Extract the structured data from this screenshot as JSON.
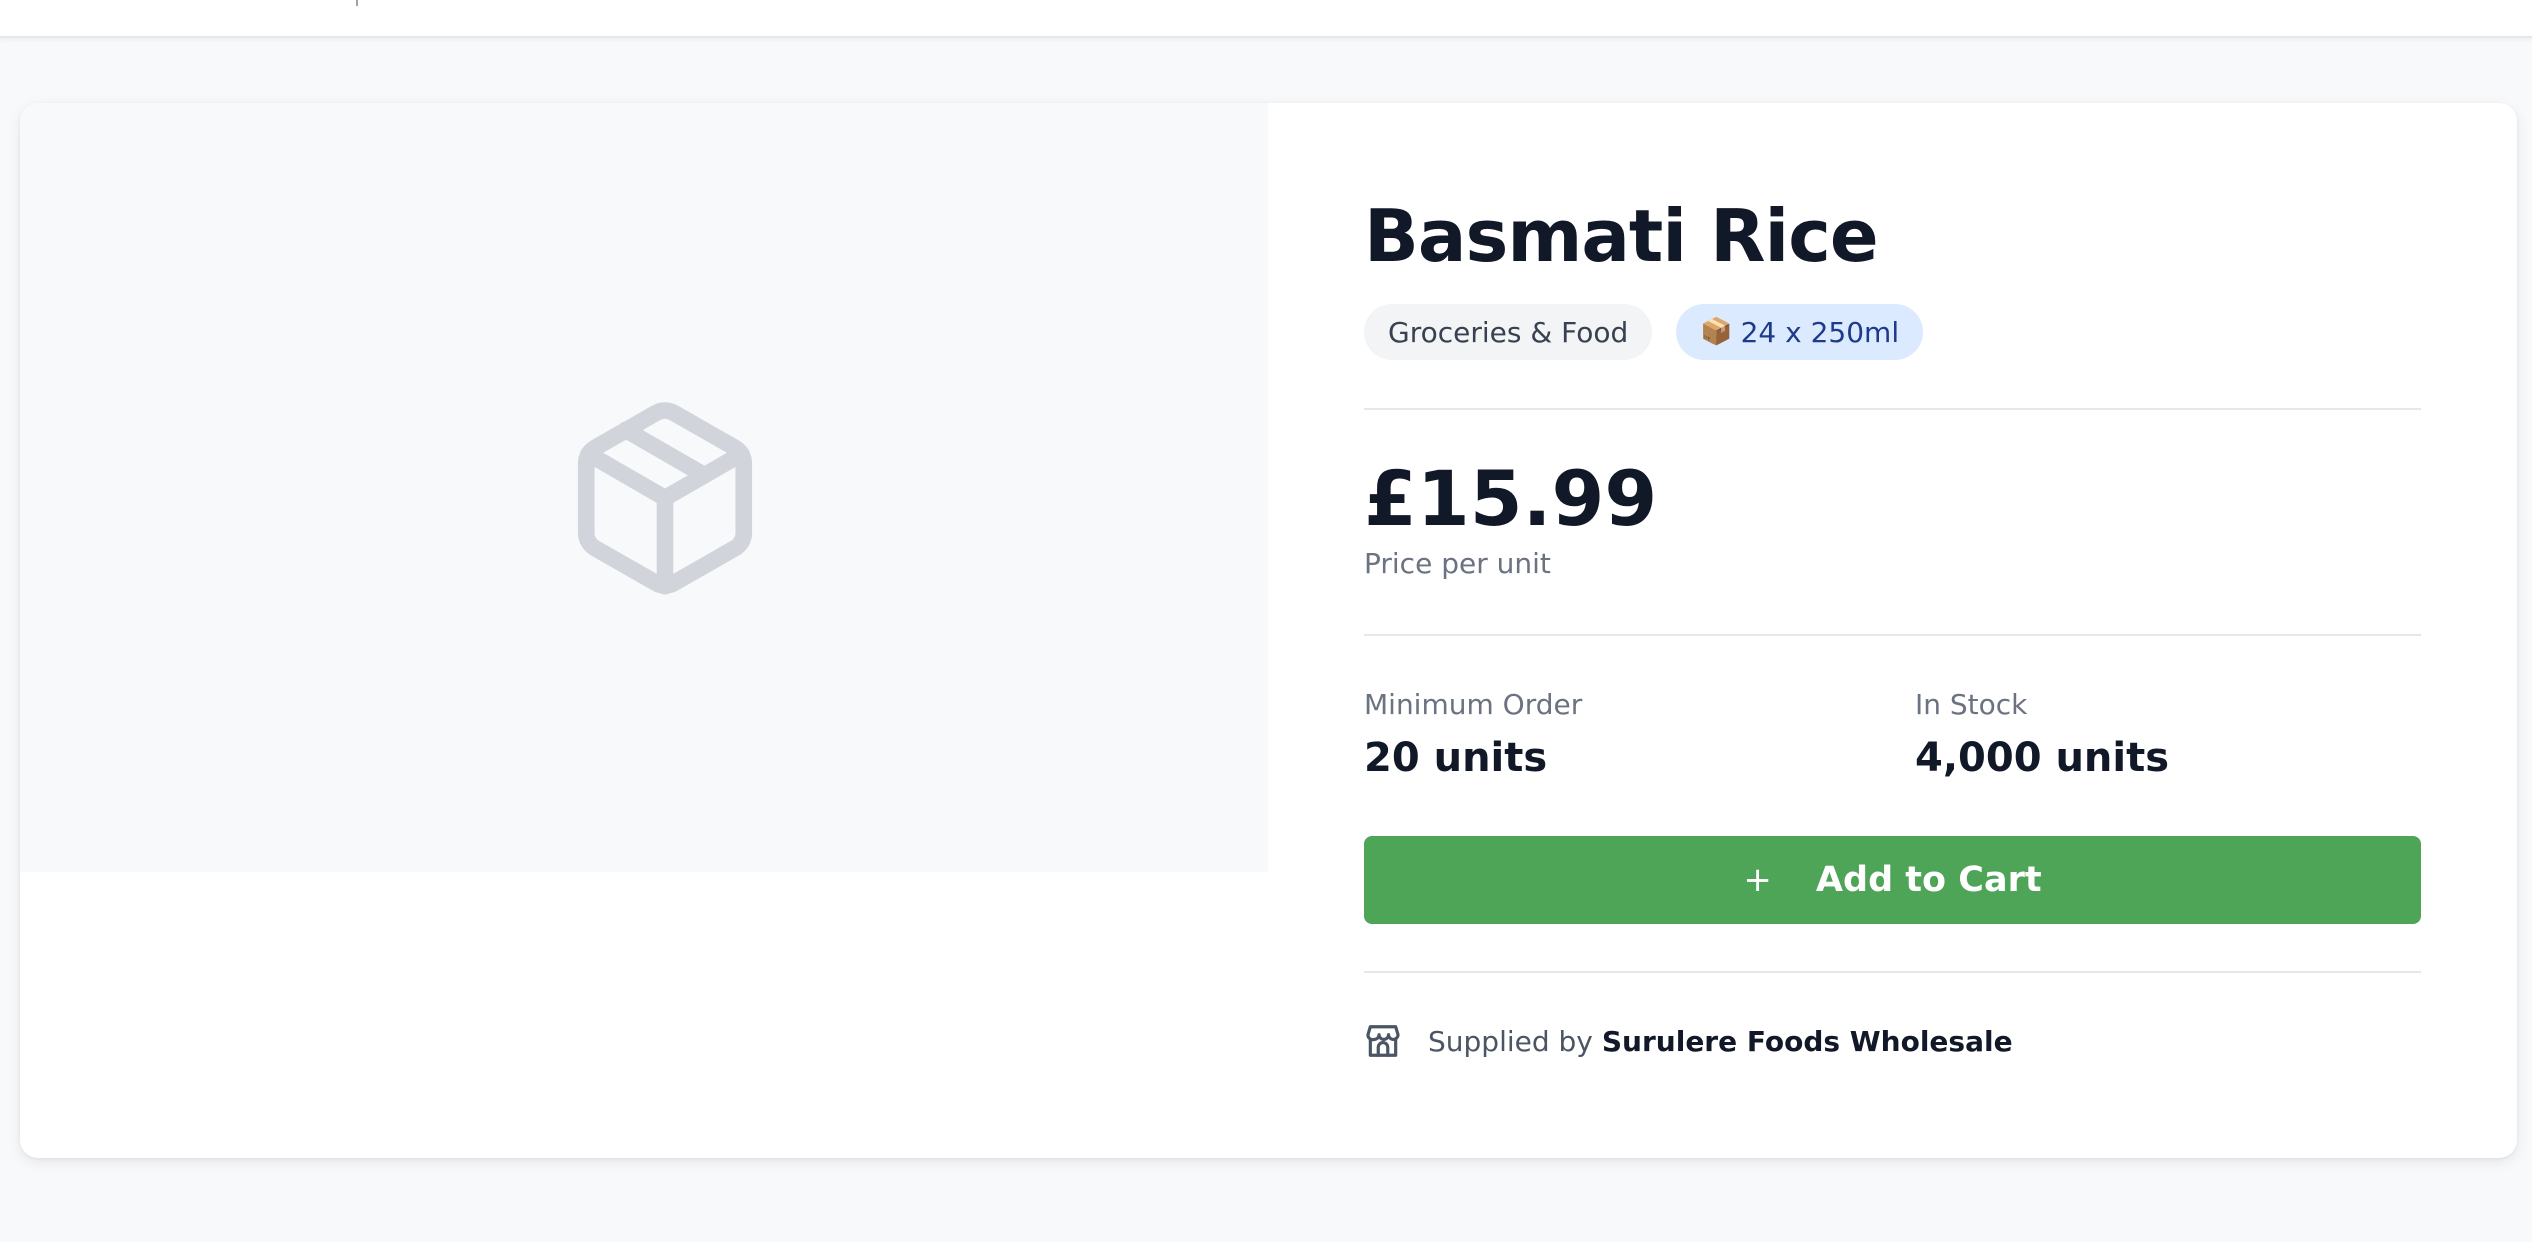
{
  "product": {
    "title": "Basmati Rice",
    "category": "Groceries & Food",
    "pack_icon": "📦",
    "pack_size": "24 x 250ml",
    "price": "£15.99",
    "price_note": "Price per unit",
    "image_icon": "package-box-icon"
  },
  "order": {
    "min_label": "Minimum Order",
    "min_value": "20 units",
    "stock_label": "In Stock",
    "stock_value": "4,000 units"
  },
  "cart": {
    "plus_icon": "+",
    "add_label": "Add to Cart"
  },
  "supplier": {
    "prefix": "Supplied by",
    "name": "Surulere Foods Wholesale",
    "icon": "store-icon"
  },
  "colors": {
    "accent_green": "#4ea457",
    "pack_badge_bg": "#dbeafe",
    "pack_badge_text": "#1e3a8a",
    "category_badge_bg": "#f3f4f6"
  }
}
